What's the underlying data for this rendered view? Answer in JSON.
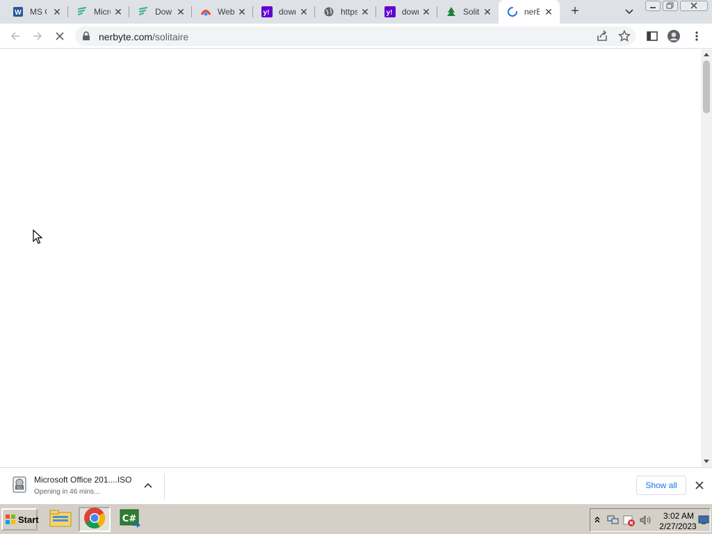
{
  "tabs": [
    {
      "title": "MS Office",
      "icon": "word-icon",
      "color": "#2b579a"
    },
    {
      "title": "Microsoft",
      "icon": "fast-icon",
      "color": "#3fb68b"
    },
    {
      "title": "Download",
      "icon": "fast-icon",
      "color": "#3fb68b"
    },
    {
      "title": "Web",
      "icon": "chrome-icon",
      "color": "#f4b400"
    },
    {
      "title": "download",
      "icon": "yahoo-icon",
      "color": "#6001d2"
    },
    {
      "title": "https",
      "icon": "globe-icon",
      "color": "#5f6368"
    },
    {
      "title": "download",
      "icon": "yahoo-icon",
      "color": "#6001d2"
    },
    {
      "title": "Solitaire",
      "icon": "tree-icon",
      "color": "#188038"
    },
    {
      "title": "nerByte",
      "icon": "loading-spinner-icon",
      "color": "#1a73e8"
    }
  ],
  "address": {
    "host": "nerbyte.com",
    "path": "/solitaire"
  },
  "download": {
    "filename": "Microsoft Office 201....ISO",
    "status": "Opening in 46 mins...",
    "show_all_label": "Show all"
  },
  "taskbar": {
    "start_label": "Start",
    "time": "3:02 AM",
    "date": "2/27/2023"
  }
}
